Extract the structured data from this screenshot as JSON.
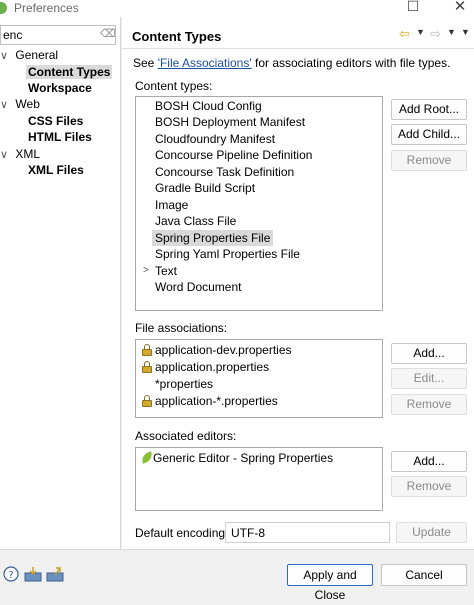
{
  "window": {
    "title": "Preferences"
  },
  "tree": {
    "filter_text": "enc",
    "items": [
      {
        "label": "General",
        "level": 0,
        "expanded": true
      },
      {
        "label": "Content Types",
        "level": 1,
        "selected": true
      },
      {
        "label": "Workspace",
        "level": 1
      },
      {
        "label": "Web",
        "level": 0,
        "expanded": true
      },
      {
        "label": "CSS Files",
        "level": 1
      },
      {
        "label": "HTML Files",
        "level": 1
      },
      {
        "label": "XML",
        "level": 0,
        "expanded": true
      },
      {
        "label": "XML Files",
        "level": 1
      }
    ]
  },
  "page": {
    "title": "Content Types",
    "desc_prefix": "See ",
    "desc_link": "'File Associations'",
    "desc_suffix": " for associating editors with file types.",
    "content_types_label": "Content types:",
    "content_types": [
      "BOSH Cloud Config",
      "BOSH Deployment Manifest",
      "Cloudfoundry Manifest",
      "Concourse Pipeline Definition",
      "Concourse Task Definition",
      "Gradle Build Script",
      "Image",
      "Java Class File",
      "Spring Properties File",
      "Spring Yaml Properties File",
      "Text",
      "Word Document"
    ],
    "selected_content_type": "Spring Properties File",
    "content_buttons": {
      "add_root": "Add Root...",
      "add_child": "Add Child...",
      "remove": "Remove"
    },
    "file_associations_label": "File associations:",
    "file_associations": [
      {
        "name": "application-dev.properties",
        "locked": true
      },
      {
        "name": "application.properties",
        "locked": true
      },
      {
        "name": "*properties",
        "locked": false
      },
      {
        "name": "application-*.properties",
        "locked": true
      }
    ],
    "file_buttons": {
      "add": "Add...",
      "edit": "Edit...",
      "remove": "Remove"
    },
    "editors_label": "Associated editors:",
    "editors": [
      "Generic Editor - Spring Properties"
    ],
    "editor_buttons": {
      "add": "Add...",
      "remove": "Remove"
    },
    "encoding_label": "Default encoding:",
    "encoding_value": "UTF-8",
    "update_label": "Update"
  },
  "footer": {
    "apply_close": "Apply and Close",
    "cancel": "Cancel"
  },
  "colors": {
    "link": "#1a4fa8",
    "selection": "#d9d9d9",
    "nav_back": "#d9a520"
  },
  "icons": [
    "help-icon",
    "import-icon",
    "export-icon",
    "lock-icon",
    "leaf-icon",
    "back-arrow-icon",
    "forward-arrow-icon"
  ]
}
